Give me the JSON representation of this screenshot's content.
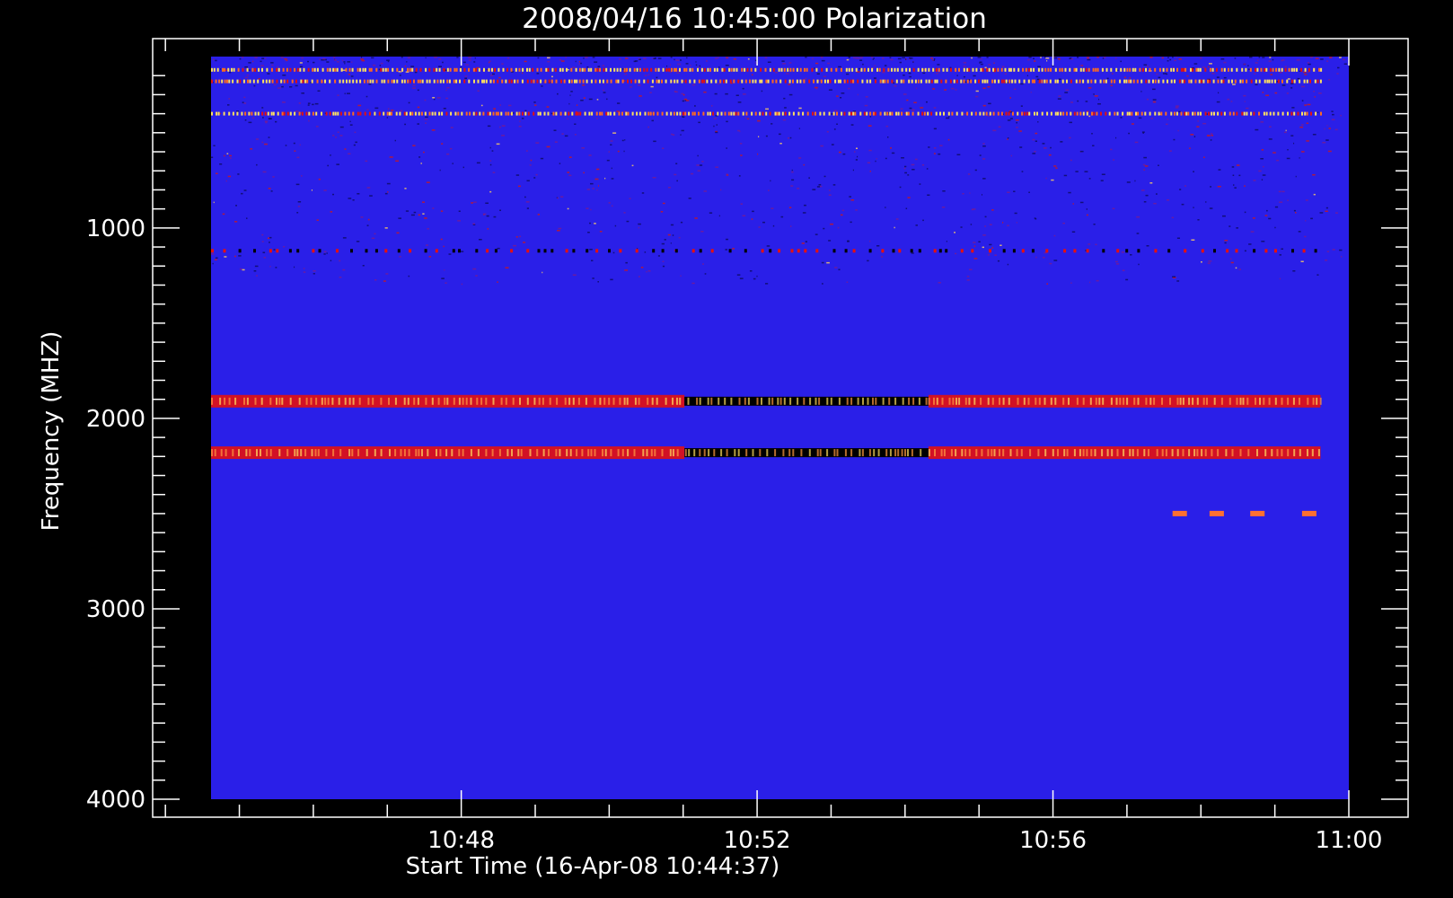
{
  "chart_data": {
    "type": "heatmap",
    "title": "2008/04/16 10:45:00 Polarization",
    "xlabel": "Start Time (16-Apr-08 10:44:37)",
    "ylabel": "Frequency (MHZ)",
    "x_range": [
      "10:44:37",
      "11:00:00"
    ],
    "y_range": [
      100,
      4000
    ],
    "y_inverted": true,
    "x_ticks": [
      "10:48",
      "10:52",
      "10:56",
      "11:00"
    ],
    "y_ticks": [
      1000,
      2000,
      3000,
      4000
    ],
    "x_tick_minutes": [
      3.383,
      7.383,
      11.383,
      15.383
    ],
    "colormap": {
      "background": "#2a1fe8",
      "low": "#000000",
      "mid": "#e41010",
      "high": "#ffe060"
    },
    "features": [
      {
        "label": "RFI band",
        "freq_mhz": 170,
        "t_start_min": 0,
        "t_end_min": 15.0,
        "strength": "high"
      },
      {
        "label": "RFI band",
        "freq_mhz": 230,
        "t_start_min": 0,
        "t_end_min": 15.0,
        "strength": "high"
      },
      {
        "label": "RFI band",
        "freq_mhz": 400,
        "t_start_min": 0,
        "t_end_min": 15.0,
        "strength": "high"
      },
      {
        "label": "RFI band",
        "freq_mhz": 1120,
        "t_start_min": 0,
        "t_end_min": 15.0,
        "strength": "mid"
      },
      {
        "label": "band",
        "freq_mhz": 1910,
        "t_start_min": 0,
        "t_end_min": 15.0,
        "strength": "mixed"
      },
      {
        "label": "band",
        "freq_mhz": 2180,
        "t_start_min": 0,
        "t_end_min": 15.0,
        "strength": "mixed"
      },
      {
        "label": "blips",
        "freq_mhz": 2500,
        "t_start_min": 13.0,
        "t_end_min": 15.0,
        "strength": "mid"
      }
    ]
  }
}
